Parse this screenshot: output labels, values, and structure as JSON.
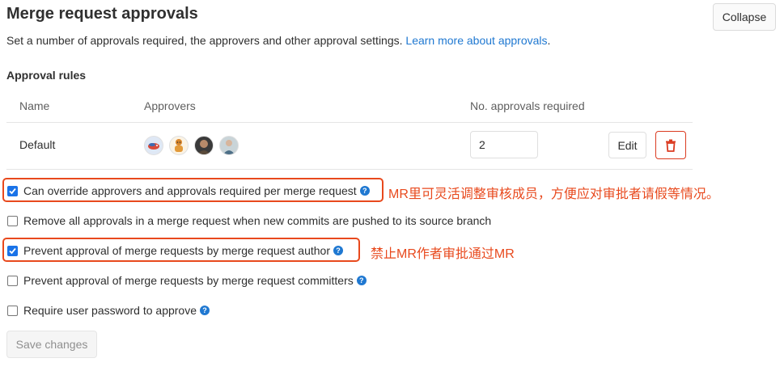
{
  "header": {
    "title": "Merge request approvals",
    "collapse_label": "Collapse",
    "description": "Set a number of approvals required, the approvers and other approval settings.",
    "learn_more_link": "Learn more about approvals",
    "description_end": "."
  },
  "approval_rules": {
    "section_title": "Approval rules",
    "columns": {
      "name": "Name",
      "approvers": "Approvers",
      "required": "No. approvals required"
    },
    "rows": [
      {
        "name": "Default",
        "approvals_required": "2",
        "edit_label": "Edit",
        "approver_avatars": [
          "avatar-bird",
          "avatar-figure",
          "avatar-person-dark",
          "avatar-person-light"
        ]
      }
    ]
  },
  "settings": [
    {
      "label": "Can override approvers and approvals required per merge request",
      "checked": true,
      "help": true
    },
    {
      "label": "Remove all approvals in a merge request when new commits are pushed to its source branch",
      "checked": false,
      "help": false
    },
    {
      "label": "Prevent approval of merge requests by merge request author",
      "checked": true,
      "help": true
    },
    {
      "label": "Prevent approval of merge requests by merge request committers",
      "checked": false,
      "help": true
    },
    {
      "label": "Require user password to approve",
      "checked": false,
      "help": true
    }
  ],
  "annotations": {
    "note_override": "MR里可灵活调整审核成员，方便应对审批者请假等情况。",
    "note_author": "禁止MR作者审批通过MR"
  },
  "footer": {
    "save_label": "Save changes"
  },
  "colors": {
    "link": "#1f78d1",
    "danger": "#db3b21",
    "annotation": "#e8491d",
    "checkbox": "#1a73e8"
  }
}
